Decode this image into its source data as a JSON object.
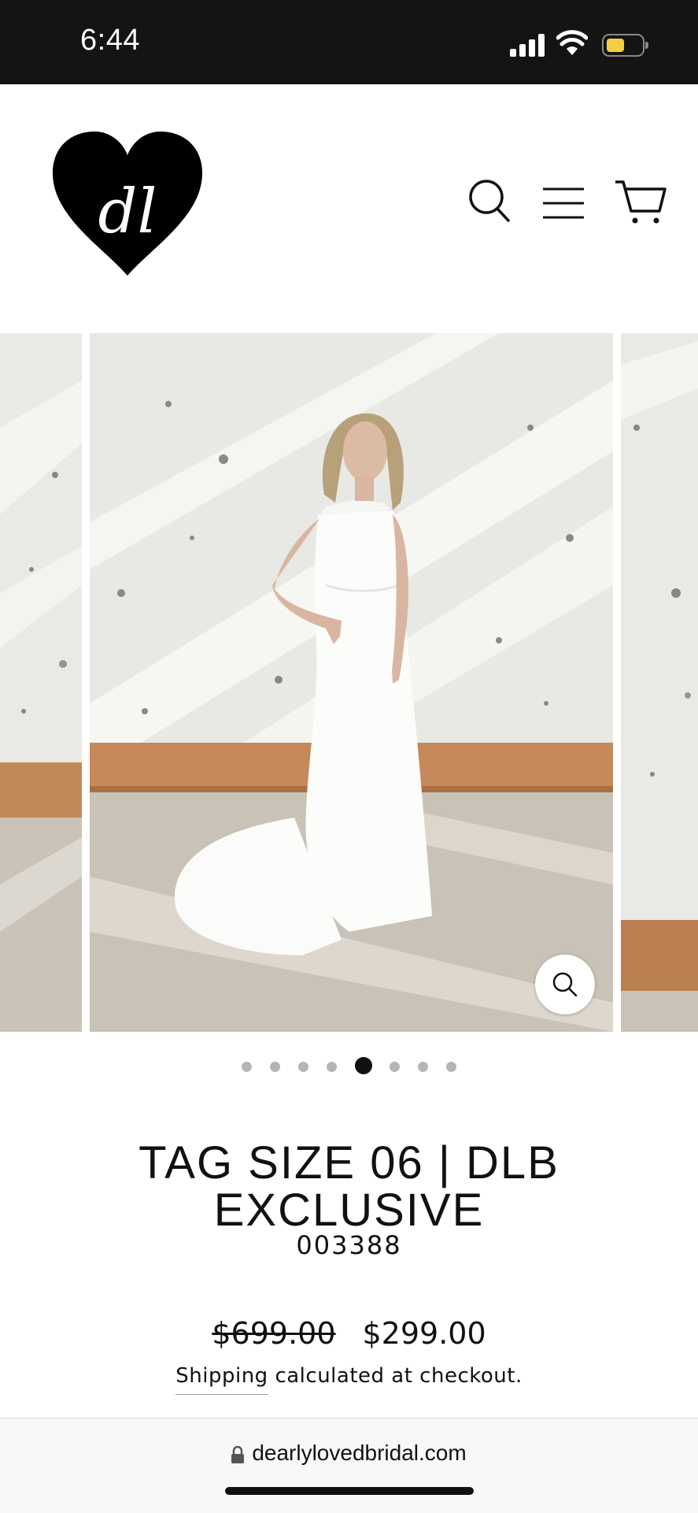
{
  "status_bar": {
    "time": "6:44"
  },
  "header": {
    "logo_text": "dl",
    "icons": [
      "search-icon",
      "menu-icon",
      "cart-icon"
    ]
  },
  "gallery": {
    "slide_count": 8,
    "active_index": 4,
    "zoom_icon": "zoom-icon"
  },
  "product": {
    "title": "TAG SIZE 06 | DLB EXCLUSIVE",
    "sku": "003388",
    "compare_price": "$699.00",
    "price": "$299.00",
    "shipping_link": "Shipping",
    "shipping_rest": " calculated at checkout."
  },
  "browser": {
    "url": "dearlylovedbridal.com"
  },
  "colors": {
    "status_bg": "#141414",
    "battery": "#f5cd46",
    "text": "#111111"
  }
}
